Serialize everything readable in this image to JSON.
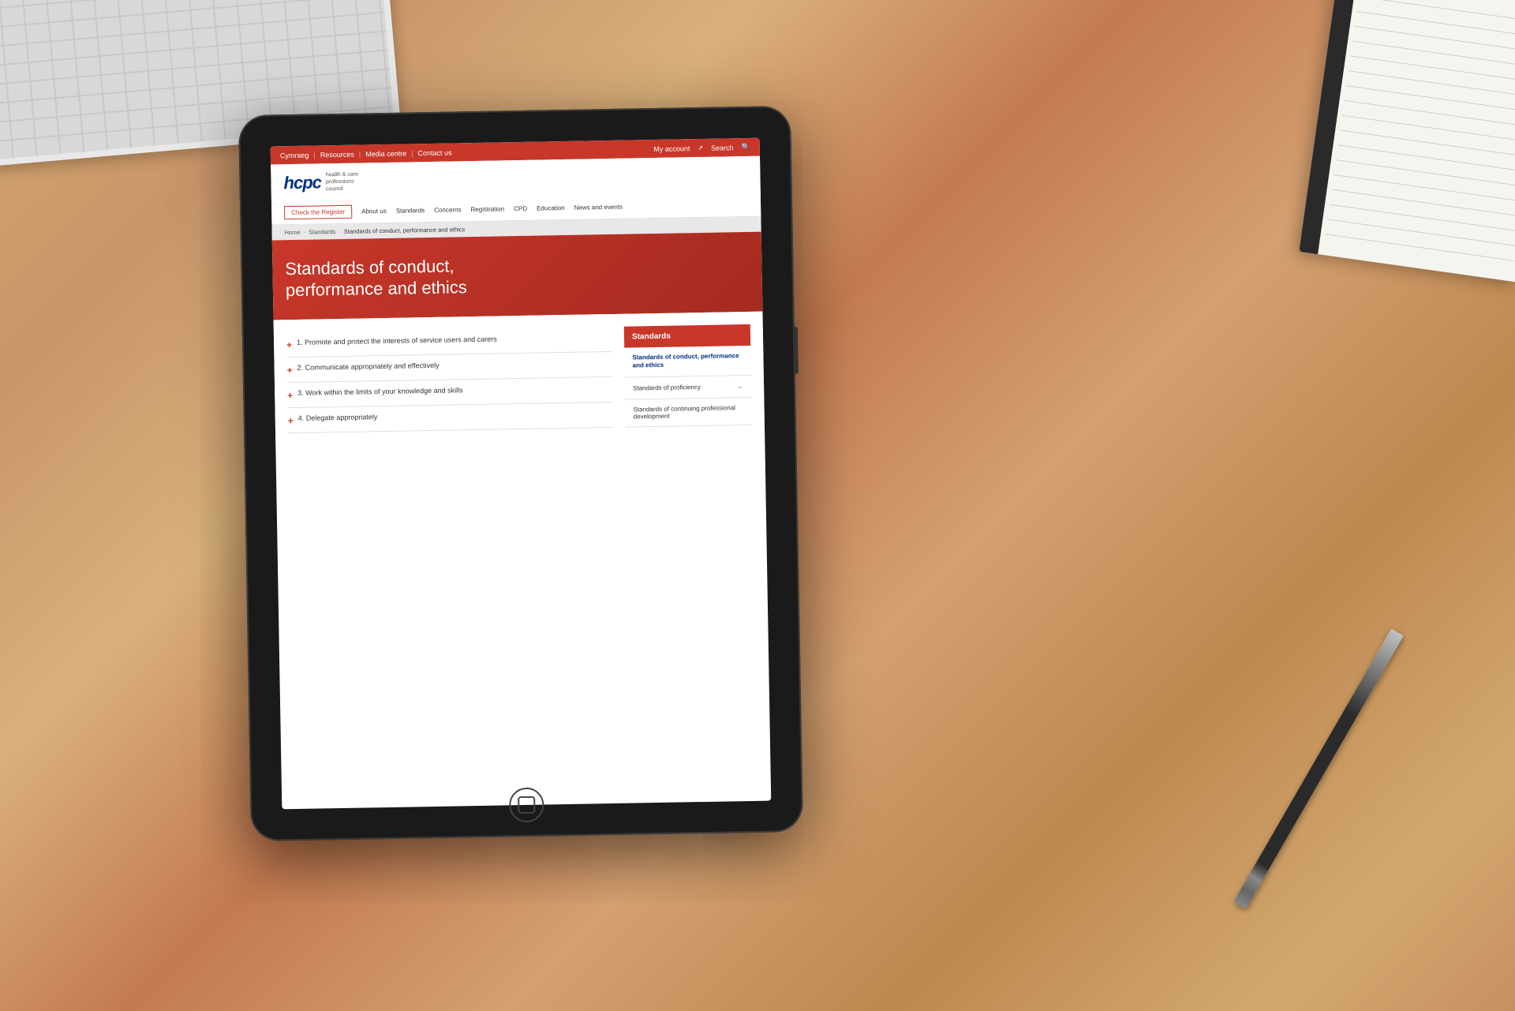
{
  "page": {
    "title": "Standards of conduct, performance and ethics"
  },
  "topbar": {
    "items": [
      {
        "label": "Cymraeg",
        "id": "cymraeg"
      },
      {
        "label": "Resources",
        "id": "resources"
      },
      {
        "label": "Media centre",
        "id": "media-centre"
      },
      {
        "label": "Contact us",
        "id": "contact-us"
      },
      {
        "label": "My account",
        "id": "my-account"
      },
      {
        "label": "Search",
        "id": "search"
      }
    ]
  },
  "logo": {
    "hcpc": "hcpc",
    "tagline_line1": "health & care",
    "tagline_line2": "professions",
    "tagline_line3": "council"
  },
  "nav": {
    "check_register": "Check the Register",
    "items": [
      {
        "label": "About us",
        "id": "about-us"
      },
      {
        "label": "Standards",
        "id": "standards"
      },
      {
        "label": "Concerns",
        "id": "concerns"
      },
      {
        "label": "Registration",
        "id": "registration"
      },
      {
        "label": "CPD",
        "id": "cpd"
      },
      {
        "label": "Education",
        "id": "education"
      },
      {
        "label": "News and events",
        "id": "news-and-events"
      }
    ]
  },
  "breadcrumb": {
    "home": "Home",
    "standards": "Standards",
    "current": "Standards of conduct, performance and ethics"
  },
  "hero": {
    "title_line1": "Standards of conduct,",
    "title_line2": "performance and ethics"
  },
  "list": {
    "items": [
      {
        "number": "1.",
        "text": "Promote and protect the interests of service users and carers"
      },
      {
        "number": "2.",
        "text": "Communicate appropriately and effectively"
      },
      {
        "number": "3.",
        "text": "Work within the limits of your knowledge and skills"
      },
      {
        "number": "4.",
        "text": "Delegate appropriately"
      }
    ]
  },
  "sidebar": {
    "heading": "Standards",
    "links": [
      {
        "label": "Standards of conduct, performance and ethics",
        "active": true,
        "id": "conduct"
      },
      {
        "label": "Standards of proficiency",
        "active": false,
        "id": "proficiency",
        "has_chevron": true
      },
      {
        "label": "Standards of continuing professional development",
        "active": false,
        "id": "cpd",
        "has_chevron": false
      }
    ]
  }
}
